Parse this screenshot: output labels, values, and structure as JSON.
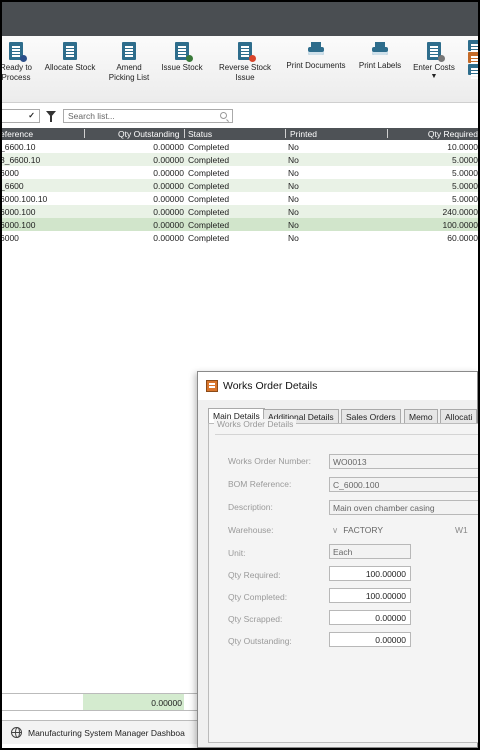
{
  "ribbon": {
    "buttons": [
      {
        "line1": "Ready to",
        "line2": "Process",
        "icon": "ready-to-process-icon"
      },
      {
        "line1": "Allocate Stock",
        "line2": "",
        "icon": "allocate-stock-icon"
      },
      {
        "line1": "Amend",
        "line2": "Picking List",
        "icon": "amend-picking-list-icon"
      },
      {
        "line1": "Issue Stock",
        "line2": "",
        "icon": "issue-stock-icon"
      },
      {
        "line1": "Reverse Stock",
        "line2": "Issue",
        "icon": "reverse-stock-issue-icon"
      },
      {
        "line1": "Print Documents",
        "line2": "",
        "icon": "printer-icon"
      },
      {
        "line1": "Print Labels",
        "line2": "",
        "icon": "printer-icon"
      },
      {
        "line1": "Enter Costs",
        "line2": "",
        "icon": "enter-costs-icon"
      }
    ]
  },
  "filter": {
    "search_placeholder": "Search list..."
  },
  "grid": {
    "columns": [
      "eference",
      "Qty Outstanding",
      "Status",
      "Printed",
      "Qty Required"
    ],
    "rows": [
      {
        "ref": "_6600.10",
        "qty_out": "0.00000",
        "status": "Completed",
        "printed": "No",
        "qty_req": "10.0000"
      },
      {
        "ref": "3_6600.10",
        "qty_out": "0.00000",
        "status": "Completed",
        "printed": "No",
        "qty_req": "5.0000"
      },
      {
        "ref": "6000",
        "qty_out": "0.00000",
        "status": "Completed",
        "printed": "No",
        "qty_req": "5.0000"
      },
      {
        "ref": "_6600",
        "qty_out": "0.00000",
        "status": "Completed",
        "printed": "No",
        "qty_req": "5.0000"
      },
      {
        "ref": "6000.100.10",
        "qty_out": "0.00000",
        "status": "Completed",
        "printed": "No",
        "qty_req": "5.0000"
      },
      {
        "ref": "6000.100",
        "qty_out": "0.00000",
        "status": "Completed",
        "printed": "No",
        "qty_req": "240.0000"
      },
      {
        "ref": "6000.100",
        "qty_out": "0.00000",
        "status": "Completed",
        "printed": "No",
        "qty_req": "100.0000"
      },
      {
        "ref": "6000",
        "qty_out": "0.00000",
        "status": "Completed",
        "printed": "No",
        "qty_req": "60.0000"
      }
    ],
    "footer_total": "0.00000"
  },
  "taskbar": {
    "label": "Manufacturing System Manager Dashboa"
  },
  "dialog": {
    "title": "Works Order Details",
    "tabs": [
      "Main Details",
      "Additional Details",
      "Sales Orders",
      "Memo",
      "Allocati"
    ],
    "group_label": "Works Order Details",
    "fields": {
      "wo_number_label": "Works Order Number:",
      "wo_number": "WO0013",
      "bom_label": "BOM Reference:",
      "bom": "C_6000.100",
      "desc_label": "Description:",
      "desc": "Main oven chamber casing",
      "warehouse_label": "Warehouse:",
      "warehouse": "FACTORY",
      "warehouse_code": "W1",
      "unit_label": "Unit:",
      "unit": "Each",
      "qty_req_label": "Qty Required:",
      "qty_req": "100.00000",
      "qty_comp_label": "Qty Completed:",
      "qty_comp": "100.00000",
      "qty_scrap_label": "Qty Scrapped:",
      "qty_scrap": "0.00000",
      "qty_out_label": "Qty Outstanding:",
      "qty_out": "0.00000"
    }
  }
}
